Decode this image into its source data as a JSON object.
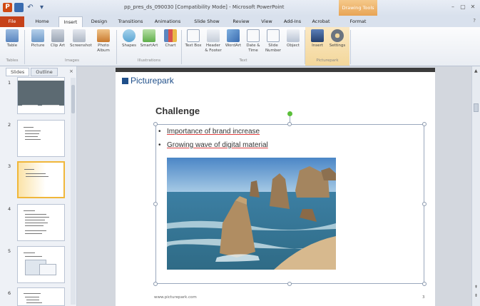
{
  "window": {
    "title": "pp_pres_ds_090030 [Compatibility Mode] - Microsoft PowerPoint",
    "context_tab_group": "Drawing Tools"
  },
  "quick_access": {
    "app_icon": "P",
    "undo": "↶",
    "redo": "↷",
    "more": "▾"
  },
  "tabs": [
    "File",
    "Home",
    "Insert",
    "Design",
    "Transitions",
    "Animations",
    "Slide Show",
    "Review",
    "View",
    "Add-Ins",
    "Acrobat",
    "Format"
  ],
  "active_tab": "Insert",
  "ribbon": {
    "buttons": [
      {
        "label": "Table",
        "icon": "table-icon"
      },
      {
        "label": "Picture",
        "icon": "picture-icon"
      },
      {
        "label": "Clip Art",
        "icon": "clip-art-icon"
      },
      {
        "label": "Screenshot",
        "icon": "screenshot-icon"
      },
      {
        "label": "Photo Album",
        "icon": "photo-album-icon"
      },
      {
        "label": "Shapes",
        "icon": "shapes-icon"
      },
      {
        "label": "SmartArt",
        "icon": "smartart-icon"
      },
      {
        "label": "Chart",
        "icon": "chart-icon"
      },
      {
        "label": "Text Box",
        "icon": "text-box-icon"
      },
      {
        "label": "Header & Footer",
        "icon": "header-footer-icon"
      },
      {
        "label": "WordArt",
        "icon": "wordart-icon"
      },
      {
        "label": "Date & Time",
        "icon": "date-time-icon"
      },
      {
        "label": "Slide Number",
        "icon": "slide-number-icon"
      },
      {
        "label": "Object",
        "icon": "object-icon"
      },
      {
        "label": "Insert",
        "icon": "insert-icon"
      },
      {
        "label": "Settings",
        "icon": "settings-icon"
      }
    ],
    "groups": [
      "Tables",
      "Images",
      "Illustrations",
      "Text",
      "Picturepark"
    ]
  },
  "pane": {
    "tabs": [
      "Slides",
      "Outline"
    ],
    "close": "×",
    "slide_numbers": [
      "1",
      "2",
      "3",
      "4",
      "5",
      "6"
    ],
    "selected": "3"
  },
  "slide": {
    "logo": "Picturepark",
    "title": "Challenge",
    "bullets": [
      "Importance of brand increase",
      "Growing wave of digital material"
    ],
    "footer": "www.picturepark.com",
    "page": "3"
  }
}
